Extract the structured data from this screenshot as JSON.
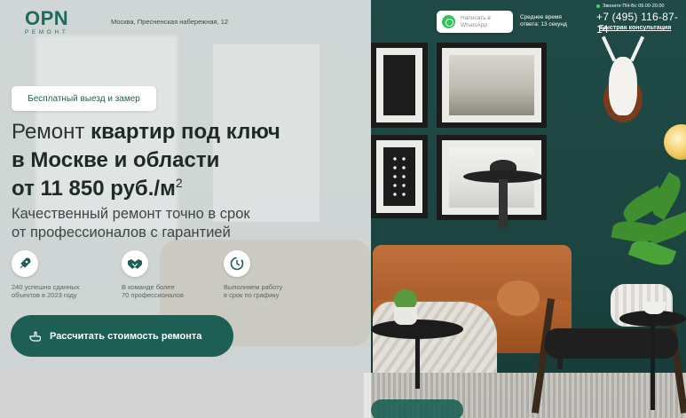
{
  "header": {
    "logo_text": "OPN",
    "logo_sub": "РЕМОНТ",
    "address": "Москва, Пресненская набережная, 12",
    "whatsapp_label_line1": "Написать в",
    "whatsapp_label_line2": "WhatsApp",
    "reply_line1": "Среднее время",
    "reply_line2": "ответа: 13 секунд",
    "hours": "Звоните ПН-Вс 09.00-20.00",
    "phone": "+7 (495) 116-87-14",
    "consult_link": "Быстрая консультация"
  },
  "hero": {
    "badge": "Бесплатный выезд и замер",
    "title_light": "Ремонт ",
    "title_bold_1": "квартир под ключ",
    "title_line2": "в Москве и области",
    "title_line3": "от 11 850 руб./м",
    "title_sup": "2",
    "subtitle_line1": "Качественный ремонт точно в срок",
    "subtitle_line2": "от профессионалов с гарантией",
    "features": [
      {
        "icon": "rocket-icon",
        "line1": "240 успешно сданных",
        "line2": "объектов в 2023 году"
      },
      {
        "icon": "handshake-icon",
        "line1": "В команде более",
        "line2": "70 профессионалов"
      },
      {
        "icon": "clock-icon",
        "line1": "Выполняем работу",
        "line2": "в срок по графику"
      }
    ],
    "cta": "Рассчитать стоимость ремонта"
  },
  "colors": {
    "brand": "#1e5f55",
    "logo": "#1e6a5e",
    "whatsapp": "#2fc45a"
  }
}
